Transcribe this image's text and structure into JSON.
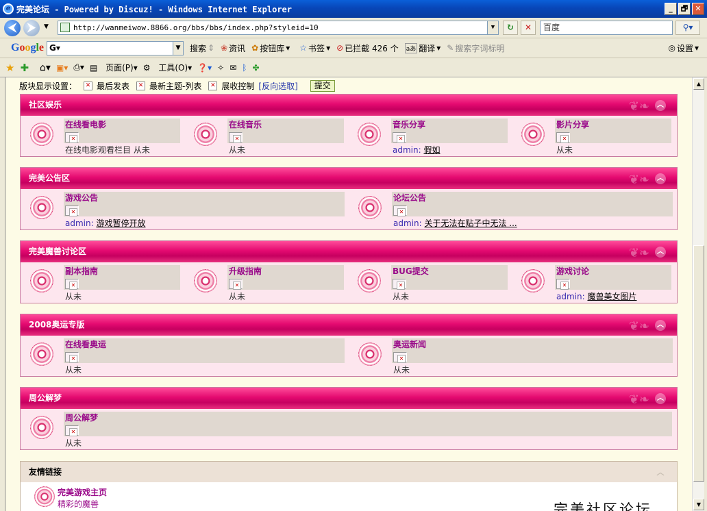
{
  "window": {
    "title": "完美论坛 - Powered by Discuz! - Windows Internet Explorer",
    "controls": [
      "_",
      "🗗",
      "✕"
    ]
  },
  "address_bar": {
    "url": "http://wanmeiwow.8866.org/bbs/bbs/index.php?styleid=10",
    "search_placeholder": "百度"
  },
  "google_toolbar": {
    "logo": "Google",
    "box_value": "G▾",
    "search": "搜索",
    "news": "资讯",
    "buttons": "按钮库",
    "bookmarks": "书签",
    "blocked": "已拦截 426 个",
    "translate": "翻译",
    "highlight": "搜索字词标明",
    "settings": "设置"
  },
  "fav_bar": {
    "page": "页面(P)",
    "tools": "工具(O)"
  },
  "settings_row": {
    "label": "版块显示设置：",
    "options": [
      "最后发表",
      "最新主题-列表",
      "展收控制"
    ],
    "invert": "[反向选取]",
    "submit": "提交"
  },
  "sections": [
    {
      "title": "社区娱乐",
      "forums": [
        {
          "name": "在线看电影",
          "last": "在线电影观看栏目  从未",
          "user": "",
          "post": ""
        },
        {
          "name": "在线音乐",
          "last": "从未",
          "user": "",
          "post": ""
        },
        {
          "name": "音乐分享",
          "last": "",
          "user": "admin:",
          "post": "假如"
        },
        {
          "name": "影片分享",
          "last": "从未",
          "user": "",
          "post": ""
        }
      ]
    },
    {
      "title": "完美公告区",
      "forums": [
        {
          "name": "游戏公告",
          "last": "",
          "user": "admin:",
          "post": "游戏暂停开放"
        },
        {
          "name": "论坛公告",
          "last": "",
          "user": "admin:",
          "post": "关于无法在贴子中无法 ..."
        }
      ]
    },
    {
      "title": "完美魔兽讨论区",
      "forums": [
        {
          "name": "副本指南",
          "last": "从未",
          "user": "",
          "post": ""
        },
        {
          "name": "升级指南",
          "last": "从未",
          "user": "",
          "post": ""
        },
        {
          "name": "BUG提交",
          "last": "从未",
          "user": "",
          "post": ""
        },
        {
          "name": "游戏讨论",
          "last": "",
          "user": "admin:",
          "post": "魔兽美女图片"
        }
      ]
    },
    {
      "title": "2008奥运专版",
      "forums": [
        {
          "name": "在线看奥运",
          "last": "从未",
          "user": "",
          "post": ""
        },
        {
          "name": "奥运新闻",
          "last": "从未",
          "user": "",
          "post": ""
        }
      ]
    },
    {
      "title": "周公解梦",
      "forums": [
        {
          "name": "周公解梦",
          "last": "从未",
          "user": "",
          "post": ""
        }
      ]
    }
  ],
  "friend_links": {
    "title": "友情链接",
    "item_title": "完美游戏主页",
    "item_desc": "精彩的魔兽",
    "site_name": "完美社区论坛"
  },
  "colors": {
    "section_header": "#e40a70",
    "forum_name": "#9a0a8a",
    "section_bg": "#fde6ee"
  }
}
